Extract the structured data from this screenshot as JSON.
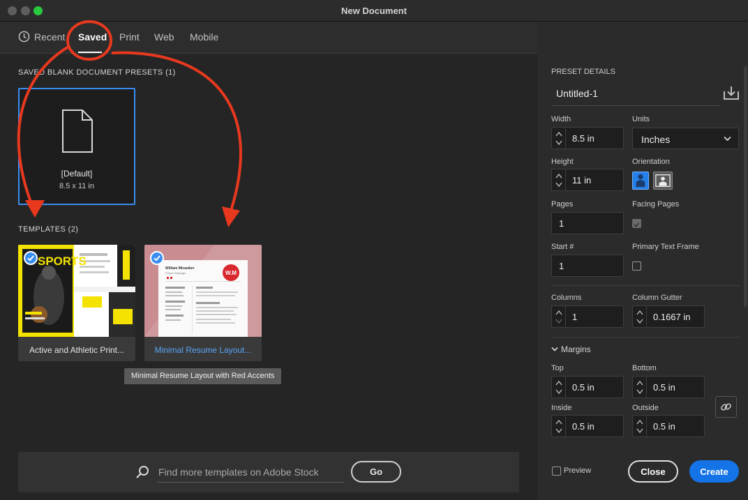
{
  "window": {
    "title": "New Document"
  },
  "tabs": [
    {
      "label": "Recent",
      "icon": "clock-icon"
    },
    {
      "label": "Saved",
      "active": true
    },
    {
      "label": "Print"
    },
    {
      "label": "Web"
    },
    {
      "label": "Mobile"
    }
  ],
  "presets": {
    "heading": "SAVED BLANK DOCUMENT PRESETS",
    "count": "(1)",
    "items": [
      {
        "name": "[Default]",
        "size": "8.5 x 11 in"
      }
    ]
  },
  "templates": {
    "heading": "TEMPLATES",
    "count": "(2)",
    "items": [
      {
        "caption": "Active and Athletic Print...",
        "thumb_text": "SPORTS"
      },
      {
        "caption": "Minimal Resume Layout...",
        "thumb_text": "W.M",
        "thumb_name": "William Micawber",
        "thumb_role": "Project Manager"
      }
    ],
    "tooltip": "Minimal Resume Layout with Red Accents"
  },
  "search": {
    "placeholder": "Find more templates on Adobe Stock",
    "go_label": "Go"
  },
  "details": {
    "heading": "PRESET DETAILS",
    "name": "Untitled-1",
    "width_label": "Width",
    "width": "8.5 in",
    "units_label": "Units",
    "units": "Inches",
    "height_label": "Height",
    "height": "11 in",
    "orientation_label": "Orientation",
    "pages_label": "Pages",
    "pages": "1",
    "facing_label": "Facing Pages",
    "facing_checked": true,
    "start_label": "Start #",
    "start": "1",
    "ptf_label": "Primary Text Frame",
    "ptf_checked": false,
    "columns_label": "Columns",
    "columns": "1",
    "gutter_label": "Column Gutter",
    "gutter": "0.1667 in",
    "margins_label": "Margins",
    "top_label": "Top",
    "top": "0.5 in",
    "bottom_label": "Bottom",
    "bottom": "0.5 in",
    "inside_label": "Inside",
    "inside": "0.5 in",
    "outside_label": "Outside",
    "outside": "0.5 in"
  },
  "footer": {
    "preview_label": "Preview",
    "close_label": "Close",
    "create_label": "Create"
  },
  "colors": {
    "accent": "#1473e6",
    "selection": "#3a8ef2",
    "annotation": "#e8391f"
  }
}
